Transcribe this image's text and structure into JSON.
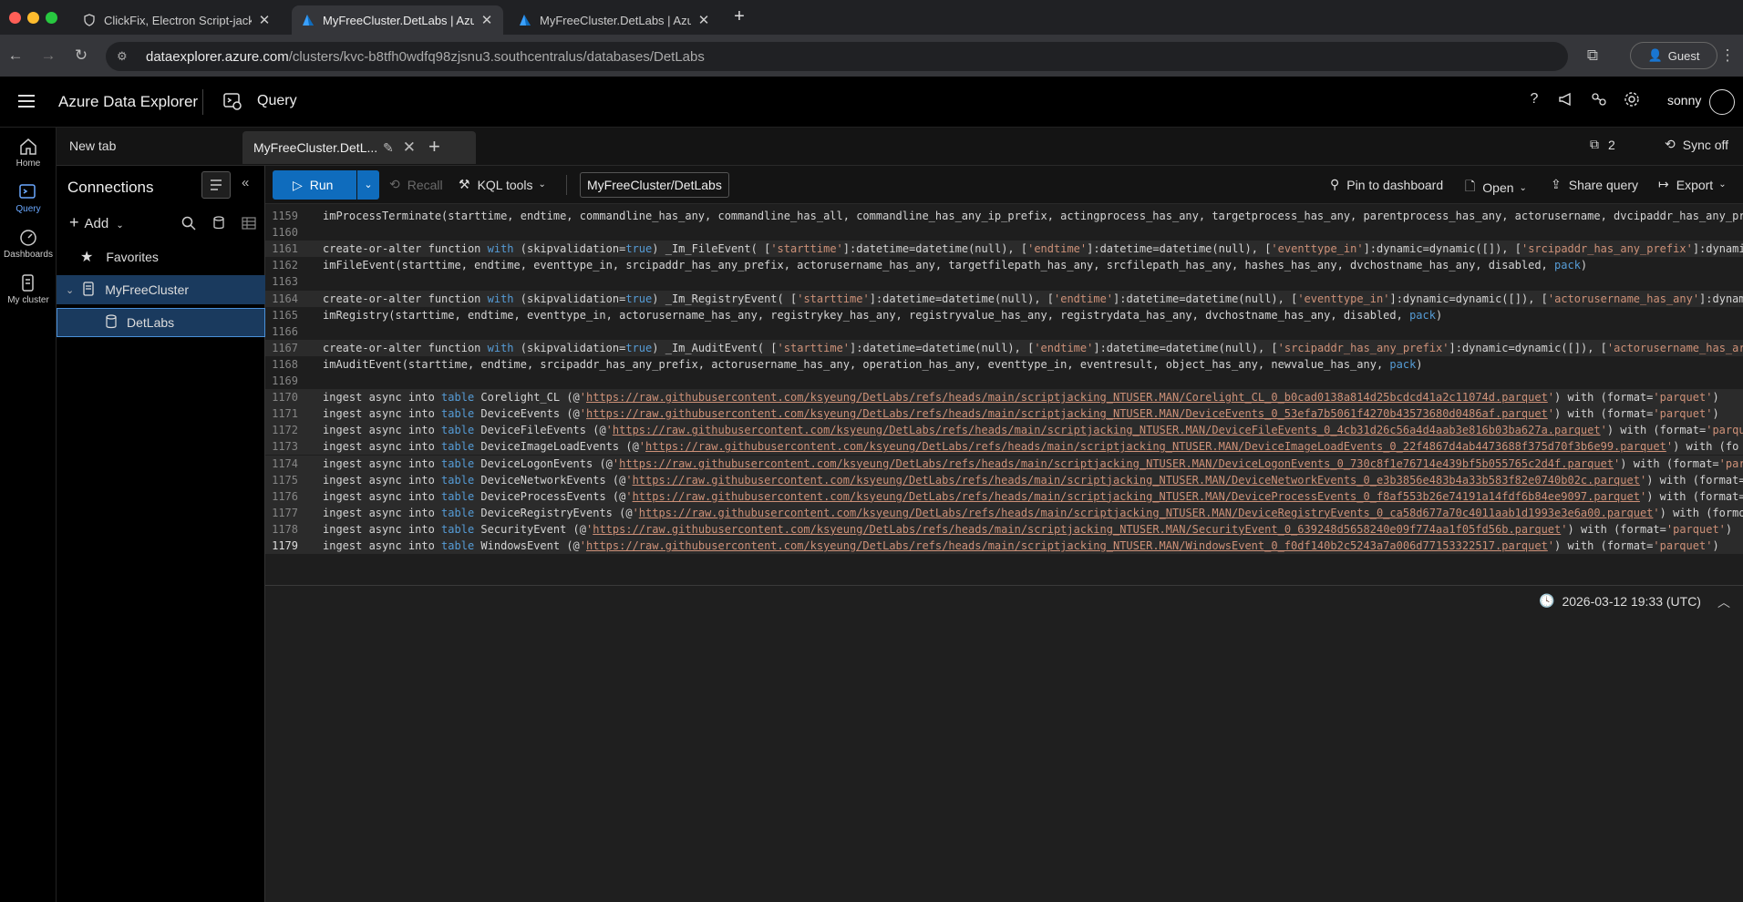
{
  "browser": {
    "tabs": [
      {
        "title": "ClickFix, Electron Script-jacking",
        "active": false
      },
      {
        "title": "MyFreeCluster.DetLabs | Azure",
        "active": true
      },
      {
        "title": "MyFreeCluster.DetLabs | Azure",
        "active": false
      }
    ],
    "url_host": "dataexplorer.azure.com",
    "url_path": "/clusters/kvc-b8tfh0wdfq98zjsnu3.southcentralus/databases/DetLabs",
    "guest_label": "Guest"
  },
  "app": {
    "title": "Azure Data Explorer",
    "section": "Query",
    "user": "sonny"
  },
  "rail": {
    "items": [
      {
        "label": "Home"
      },
      {
        "label": "Query"
      },
      {
        "label": "Dashboards"
      },
      {
        "label": "My cluster"
      }
    ]
  },
  "qtabs": {
    "new_tab": "New tab",
    "active_tab": "MyFreeCluster.DetLabs",
    "active_tab_display": "MyFreeCluster.DetL...",
    "count": "2",
    "sync": "Sync off"
  },
  "connections": {
    "title": "Connections",
    "add_label": "Add",
    "favorites": "Favorites",
    "cluster": "MyFreeCluster",
    "database": "DetLabs"
  },
  "toolbar": {
    "run": "Run",
    "recall": "Recall",
    "kql_tools": "KQL tools",
    "db_context": "MyFreeCluster/DetLabs",
    "pin": "Pin to dashboard",
    "open": "Open",
    "share": "Share query",
    "export": "Export"
  },
  "editor": {
    "lines": [
      {
        "n": "1159",
        "segments": [
          {
            "t": "imProcessTerminate(starttime, endtime, commandline_has_any, commandline_has_all, commandline_has_any_ip_prefix, actingprocess_has_any, targetprocess_has_any, parentprocess_has_any, actorusername, dvcipaddr_has_any_pr"
          }
        ]
      },
      {
        "n": "1160",
        "segments": []
      },
      {
        "n": "1161",
        "hl": true,
        "segments": [
          {
            "t": "create-or-alter function "
          },
          {
            "t": "with",
            "c": "kw"
          },
          {
            "t": " (skipvalidation="
          },
          {
            "t": "true",
            "c": "kw"
          },
          {
            "t": ") _Im_FileEvent( ["
          },
          {
            "t": "'starttime'",
            "c": "str"
          },
          {
            "t": "]:datetime=datetime(null), ["
          },
          {
            "t": "'endtime'",
            "c": "str"
          },
          {
            "t": "]:datetime=datetime(null), ["
          },
          {
            "t": "'eventtype_in'",
            "c": "str"
          },
          {
            "t": "]:dynamic=dynamic([]), ["
          },
          {
            "t": "'srcipaddr_has_any_prefix'",
            "c": "str"
          },
          {
            "t": "]:dynami"
          }
        ]
      },
      {
        "n": "1162",
        "segments": [
          {
            "t": "imFileEvent(starttime, endtime, eventtype_in, srcipaddr_has_any_prefix, actorusername_has_any, targetfilepath_has_any, srcfilepath_has_any, hashes_has_any, dvchostname_has_any, disabled, "
          },
          {
            "t": "pack",
            "c": "kw"
          },
          {
            "t": ")"
          }
        ]
      },
      {
        "n": "1163",
        "segments": []
      },
      {
        "n": "1164",
        "hl": true,
        "segments": [
          {
            "t": "create-or-alter function "
          },
          {
            "t": "with",
            "c": "kw"
          },
          {
            "t": " (skipvalidation="
          },
          {
            "t": "true",
            "c": "kw"
          },
          {
            "t": ") _Im_RegistryEvent( ["
          },
          {
            "t": "'starttime'",
            "c": "str"
          },
          {
            "t": "]:datetime=datetime(null), ["
          },
          {
            "t": "'endtime'",
            "c": "str"
          },
          {
            "t": "]:datetime=datetime(null), ["
          },
          {
            "t": "'eventtype_in'",
            "c": "str"
          },
          {
            "t": "]:dynamic=dynamic([]), ["
          },
          {
            "t": "'actorusername_has_any'",
            "c": "str"
          },
          {
            "t": "]:dynam"
          }
        ]
      },
      {
        "n": "1165",
        "segments": [
          {
            "t": "imRegistry(starttime, endtime, eventtype_in, actorusername_has_any, registrykey_has_any, registryvalue_has_any, registrydata_has_any, dvchostname_has_any, disabled, "
          },
          {
            "t": "pack",
            "c": "kw"
          },
          {
            "t": ")"
          }
        ]
      },
      {
        "n": "1166",
        "segments": []
      },
      {
        "n": "1167",
        "hl": true,
        "segments": [
          {
            "t": "create-or-alter function "
          },
          {
            "t": "with",
            "c": "kw"
          },
          {
            "t": " (skipvalidation="
          },
          {
            "t": "true",
            "c": "kw"
          },
          {
            "t": ") _Im_AuditEvent( ["
          },
          {
            "t": "'starttime'",
            "c": "str"
          },
          {
            "t": "]:datetime=datetime(null), ["
          },
          {
            "t": "'endtime'",
            "c": "str"
          },
          {
            "t": "]:datetime=datetime(null), ["
          },
          {
            "t": "'srcipaddr_has_any_prefix'",
            "c": "str"
          },
          {
            "t": "]:dynamic=dynamic([]), ["
          },
          {
            "t": "'actorusername_has_ar",
            "c": "str"
          }
        ]
      },
      {
        "n": "1168",
        "segments": [
          {
            "t": "imAuditEvent(starttime, endtime, srcipaddr_has_any_prefix, actorusername_has_any, operation_has_any, eventtype_in, eventresult, object_has_any, newvalue_has_any, "
          },
          {
            "t": "pack",
            "c": "kw"
          },
          {
            "t": ")"
          }
        ]
      },
      {
        "n": "1169",
        "segments": []
      },
      {
        "n": "1170",
        "hl": true,
        "segments": [
          {
            "t": "ingest async into "
          },
          {
            "t": "table",
            "c": "kw"
          },
          {
            "t": " Corelight_CL (@"
          },
          {
            "t": "'",
            "c": "str"
          },
          {
            "t": "https://raw.githubusercontent.com/ksyeung/DetLabs/refs/heads/main/scriptjacking_NTUSER.MAN/Corelight_CL_0_b0cad0138a814d25bcdcd41a2c11074d.parquet",
            "c": "url"
          },
          {
            "t": "'",
            "c": "str"
          },
          {
            "t": ") with (format="
          },
          {
            "t": "'parquet'",
            "c": "str"
          },
          {
            "t": ")"
          }
        ]
      },
      {
        "n": "1171",
        "hl": true,
        "segments": [
          {
            "t": "ingest async into "
          },
          {
            "t": "table",
            "c": "kw"
          },
          {
            "t": " DeviceEvents (@"
          },
          {
            "t": "'",
            "c": "str"
          },
          {
            "t": "https://raw.githubusercontent.com/ksyeung/DetLabs/refs/heads/main/scriptjacking_NTUSER.MAN/DeviceEvents_0_53efa7b5061f4270b43573680d0486af.parquet",
            "c": "url"
          },
          {
            "t": "'",
            "c": "str"
          },
          {
            "t": ") with (format="
          },
          {
            "t": "'parquet'",
            "c": "str"
          },
          {
            "t": ")"
          }
        ]
      },
      {
        "n": "1172",
        "hl": true,
        "segments": [
          {
            "t": "ingest async into "
          },
          {
            "t": "table",
            "c": "kw"
          },
          {
            "t": " DeviceFileEvents (@"
          },
          {
            "t": "'",
            "c": "str"
          },
          {
            "t": "https://raw.githubusercontent.com/ksyeung/DetLabs/refs/heads/main/scriptjacking_NTUSER.MAN/DeviceFileEvents_0_4cb31d26c56a4d4aab3e816b03ba627a.parquet",
            "c": "url"
          },
          {
            "t": "'",
            "c": "str"
          },
          {
            "t": ") with (format="
          },
          {
            "t": "'parqu",
            "c": "str"
          }
        ]
      },
      {
        "n": "1173",
        "hl": true,
        "segments": [
          {
            "t": "ingest async into "
          },
          {
            "t": "table",
            "c": "kw"
          },
          {
            "t": " DeviceImageLoadEvents (@"
          },
          {
            "t": "'",
            "c": "str"
          },
          {
            "t": "https://raw.githubusercontent.com/ksyeung/DetLabs/refs/heads/main/scriptjacking_NTUSER.MAN/DeviceImageLoadEvents_0_22f4867d4ab4473688f375d70f3b6e99.parquet",
            "c": "url"
          },
          {
            "t": "'",
            "c": "str"
          },
          {
            "t": ") with (fo"
          }
        ]
      },
      {
        "n": "1174",
        "hl": true,
        "segments": [
          {
            "t": "ingest async into "
          },
          {
            "t": "table",
            "c": "kw"
          },
          {
            "t": " DeviceLogonEvents (@"
          },
          {
            "t": "'",
            "c": "str"
          },
          {
            "t": "https://raw.githubusercontent.com/ksyeung/DetLabs/refs/heads/main/scriptjacking_NTUSER.MAN/DeviceLogonEvents_0_730c8f1e76714e439bf5b055765c2d4f.parquet",
            "c": "url"
          },
          {
            "t": "'",
            "c": "str"
          },
          {
            "t": ") with (format="
          },
          {
            "t": "'par",
            "c": "str"
          }
        ]
      },
      {
        "n": "1175",
        "hl": true,
        "segments": [
          {
            "t": "ingest async into "
          },
          {
            "t": "table",
            "c": "kw"
          },
          {
            "t": " DeviceNetworkEvents (@"
          },
          {
            "t": "'",
            "c": "str"
          },
          {
            "t": "https://raw.githubusercontent.com/ksyeung/DetLabs/refs/heads/main/scriptjacking_NTUSER.MAN/DeviceNetworkEvents_0_e3b3856e483b4a33b583f82e0740b02c.parquet",
            "c": "url"
          },
          {
            "t": "'",
            "c": "str"
          },
          {
            "t": ") with (format="
          }
        ]
      },
      {
        "n": "1176",
        "hl": true,
        "segments": [
          {
            "t": "ingest async into "
          },
          {
            "t": "table",
            "c": "kw"
          },
          {
            "t": " DeviceProcessEvents (@"
          },
          {
            "t": "'",
            "c": "str"
          },
          {
            "t": "https://raw.githubusercontent.com/ksyeung/DetLabs/refs/heads/main/scriptjacking_NTUSER.MAN/DeviceProcessEvents_0_f8af553b26e74191a14fdf6b84ee9097.parquet",
            "c": "url"
          },
          {
            "t": "'",
            "c": "str"
          },
          {
            "t": ") with (format="
          }
        ]
      },
      {
        "n": "1177",
        "hl": true,
        "segments": [
          {
            "t": "ingest async into "
          },
          {
            "t": "table",
            "c": "kw"
          },
          {
            "t": " DeviceRegistryEvents (@"
          },
          {
            "t": "'",
            "c": "str"
          },
          {
            "t": "https://raw.githubusercontent.com/ksyeung/DetLabs/refs/heads/main/scriptjacking_NTUSER.MAN/DeviceRegistryEvents_0_ca58d677a70c4011aab1d1993e3e6a00.parquet",
            "c": "url"
          },
          {
            "t": "'",
            "c": "str"
          },
          {
            "t": ") with (formo"
          }
        ]
      },
      {
        "n": "1178",
        "hl": true,
        "segments": [
          {
            "t": "ingest async into "
          },
          {
            "t": "table",
            "c": "kw"
          },
          {
            "t": " SecurityEvent (@"
          },
          {
            "t": "'",
            "c": "str"
          },
          {
            "t": "https://raw.githubusercontent.com/ksyeung/DetLabs/refs/heads/main/scriptjacking_NTUSER.MAN/SecurityEvent_0_639248d5658240e09f774aa1f05fd56b.parquet",
            "c": "url"
          },
          {
            "t": "'",
            "c": "str"
          },
          {
            "t": ") with (format="
          },
          {
            "t": "'parquet'",
            "c": "str"
          },
          {
            "t": ")"
          }
        ]
      },
      {
        "n": "1179",
        "hl": true,
        "cur": true,
        "segments": [
          {
            "t": "ingest async into "
          },
          {
            "t": "table",
            "c": "kw"
          },
          {
            "t": " WindowsEvent (@"
          },
          {
            "t": "'",
            "c": "str"
          },
          {
            "t": "https://raw.githubusercontent.com/ksyeung/DetLabs/refs/heads/main/scriptjacking_NTUSER.MAN/WindowsEvent_0_f0df140b2c5243a7a006d77153322517.parquet",
            "c": "url"
          },
          {
            "t": "'",
            "c": "str"
          },
          {
            "t": ") with (format="
          },
          {
            "t": "'parquet'",
            "c": "str"
          },
          {
            "t": ")"
          }
        ]
      }
    ]
  },
  "results": {
    "timestamp": "2026-03-12 19:33 (UTC)"
  }
}
